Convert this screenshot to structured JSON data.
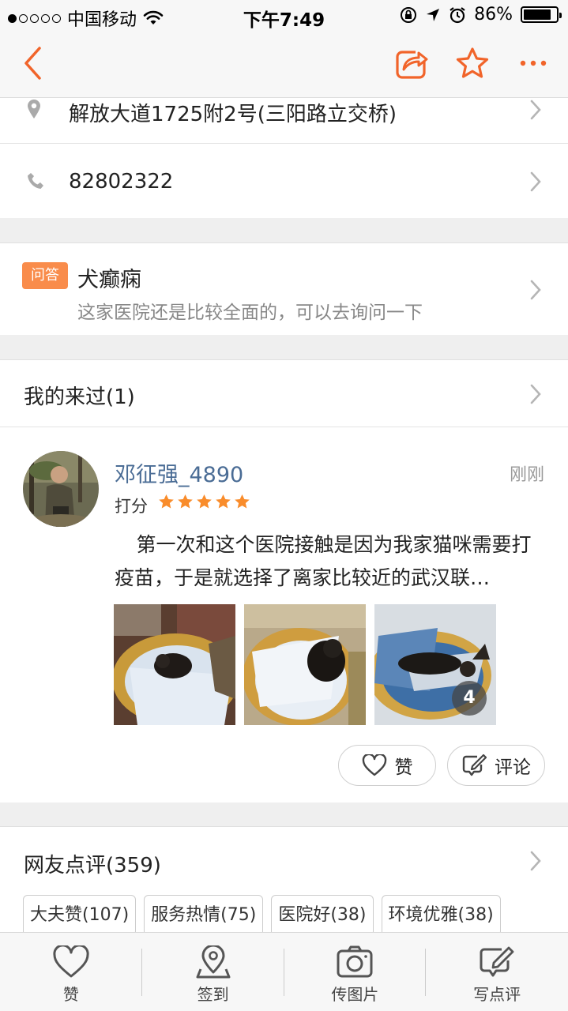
{
  "status_bar": {
    "carrier": "中国移动",
    "time": "下午7:49",
    "battery": "86%",
    "battery_level": 0.86
  },
  "nav": {
    "back_icon": "chevron-left-icon",
    "share_icon": "share-icon",
    "favorite_icon": "star-outline-icon",
    "more_icon": "more-dots-icon",
    "accent_color": "#f1642a"
  },
  "address": {
    "icon": "location-pin-icon",
    "text": "解放大道1725附2号(三阳路立交桥)"
  },
  "phone": {
    "icon": "phone-icon",
    "text": "82802322"
  },
  "qa": {
    "badge": "问答",
    "title": "犬癫痫",
    "answer": "这家医院还是比较全面的，可以去询问一下"
  },
  "visited": {
    "label": "我的来过(1)"
  },
  "review": {
    "user": "邓征强_4890",
    "time": "刚刚",
    "score_label": "打分",
    "rating": 5,
    "text": "第一次和这个医院接触是因为我家猫咪需要打疫苗，于是就选择了离家比较近的武汉联…",
    "photo_count": "4",
    "like_label": "赞",
    "comment_label": "评论"
  },
  "reviews": {
    "header": "网友点评(359)",
    "tags": [
      "大夫赞(107)",
      "服务热情(75)",
      "医院好(38)",
      "环境优雅(38)"
    ]
  },
  "bottom_tabs": [
    {
      "label": "赞",
      "icon": "heart-icon"
    },
    {
      "label": "签到",
      "icon": "checkin-pin-icon"
    },
    {
      "label": "传图片",
      "icon": "camera-icon"
    },
    {
      "label": "写点评",
      "icon": "write-review-icon"
    }
  ]
}
